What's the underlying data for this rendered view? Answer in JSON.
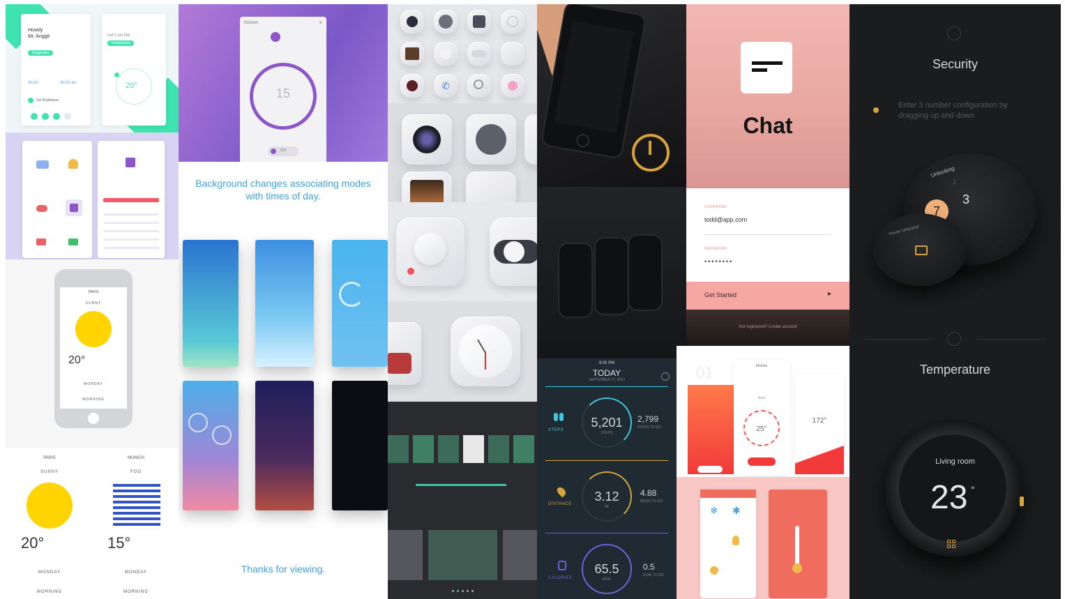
{
  "tiles": {
    "weather_top": {
      "card1": {
        "greeting": "Howdy",
        "name": "Mr. Anggit",
        "pill": "Suggested",
        "stat_left": "30,221",
        "stat_right": "30,221 km",
        "row_label": "Set Brightness"
      },
      "card2": {
        "hint": "Let's set the",
        "pill": "Temperature",
        "temp": "20°"
      }
    },
    "purple_kitchen": {
      "title": "Kitchen",
      "dial_value": "15",
      "toggle_label": "On"
    },
    "background_modes": {
      "headline": "Background changes associating modes with times of day.",
      "footer": "Thanks for viewing."
    },
    "chat": {
      "logo_title": "Chat",
      "username_label": "USERNAME",
      "username_value": "todd@app.com",
      "password_label": "PASSWORD",
      "password_mask": "••••••••",
      "cta_label": "Get Started",
      "footer": "Not registered? Create account"
    },
    "security": {
      "title": "Security",
      "instruction": "Enter 3 number configuration by dragging up and down",
      "dial_status": "Unlocking",
      "digit_a": "7",
      "digit_b": "3",
      "digit_c": "2",
      "lock_label": "House Unlocked"
    },
    "temperature": {
      "title": "Temperature",
      "room": "Living room",
      "value": "23",
      "unit": "°"
    },
    "fitness": {
      "clock": "9:00 PM",
      "day": "TODAY",
      "date": "SEPTEMBER 17, 2013",
      "rows": [
        {
          "label": "STEPS",
          "value": "5,201",
          "sub": "STEPS",
          "side": "2,799",
          "side_sub": "STEPS TO GO"
        },
        {
          "label": "DISTANCE",
          "value": "3.12",
          "sub": "MI",
          "side": "4.88",
          "side_sub": "MILES TO GO"
        },
        {
          "label": "CALORIES",
          "value": "65.5",
          "sub": "KCAL",
          "side": "0.5",
          "side_sub": "KCAL TO GO"
        }
      ]
    },
    "weather_phone": {
      "city": "PARIS",
      "cond": "SUNNY",
      "temp": "20°",
      "day": "MONDAY",
      "time": "MORNING"
    },
    "weather_bottom": [
      {
        "city": "PARIS",
        "cond": "SUNNY",
        "temp": "20°",
        "day": "MONDAY",
        "time": "MORNING"
      },
      {
        "city": "MUNICH",
        "cond": "FOG",
        "temp": "15°",
        "day": "MONDAY",
        "time": "MORNING"
      }
    ],
    "smart_home": {
      "title": "Kitchen",
      "mode": "Auto",
      "dial": "25°",
      "value": "172°",
      "step": "01"
    }
  },
  "colors": {
    "accent_blue": "#3fa2de",
    "chat_pink": "#f6a7a3",
    "fitness_cyan": "#3ec8dd",
    "fitness_gold": "#d7a43b",
    "fitness_violet": "#6c63d8",
    "sun": "#ffd400",
    "purple": "#8d57c7"
  }
}
